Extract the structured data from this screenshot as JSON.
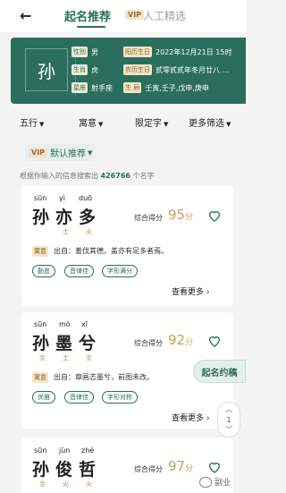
{
  "header": {
    "back_icon": "←",
    "tab_active": "起名推荐",
    "vip_label": "VIP",
    "tab_vip": "人工精选"
  },
  "info": {
    "surname": "孙",
    "gender_label": "性别",
    "gender": "男",
    "solar_label": "阳历生日",
    "solar": "2022年12月21日 15时",
    "zodiac_label": "生肖",
    "zodiac": "虎",
    "lunar_label": "农历生日",
    "lunar": "贰零贰贰年冬月廿八 ...",
    "sign_label": "星座",
    "sign": "射手座",
    "bazi_label": "生 辰",
    "bazi": "壬寅,壬子,戊申,庚申"
  },
  "filters": {
    "wuxing": "五行",
    "yuyi": "寓意",
    "xianding": "限定字",
    "more": "更多筛选",
    "vip": "VIP",
    "sort": "默认推荐"
  },
  "summary": {
    "prefix": "根据你输入的信息搜索出",
    "count": "426766",
    "suffix": "个名字"
  },
  "cards": [
    {
      "py": [
        "sūn",
        "yì",
        "duō"
      ],
      "hz": [
        "孙",
        "亦",
        "多"
      ],
      "el": [
        "",
        "土",
        "火"
      ],
      "score_label": "综合得分",
      "score": "95",
      "score_unit": "分",
      "source_tag": "寓意",
      "source_text": "出自：羞伐其德。盖亦有足多者焉。",
      "chips": [
        "勤恳",
        "音律佳",
        "字形满分"
      ],
      "more": "查看更多",
      "more_icon": "›"
    },
    {
      "py": [
        "sūn",
        "mò",
        "xī"
      ],
      "hz": [
        "孙",
        "墨",
        "兮"
      ],
      "el": [
        "金",
        "土",
        "金"
      ],
      "score_label": "综合得分",
      "score": "92",
      "score_unit": "分",
      "source_tag": "寓意",
      "source_text": "出自：章画志墨兮，前图未改。",
      "chips": [
        "优雅",
        "音律佳",
        "字形对称"
      ],
      "more": "查看更多",
      "more_icon": "›"
    },
    {
      "py": [
        "sūn",
        "jùn",
        "zhé"
      ],
      "hz": [
        "孙",
        "俊",
        "哲"
      ],
      "el": [
        "金",
        "火",
        "火"
      ],
      "score_label": "综合得分",
      "score": "97",
      "score_unit": "分"
    }
  ],
  "float": {
    "qiming": "起名约稿",
    "page": "1",
    "up": "︿",
    "down": "﹀"
  },
  "watermark": "副业"
}
